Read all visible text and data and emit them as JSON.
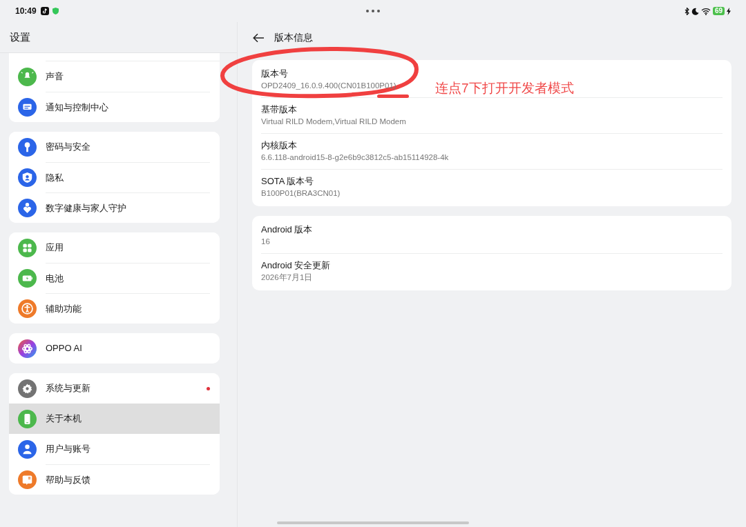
{
  "status_bar": {
    "time": "10:49",
    "battery": "69"
  },
  "sidebar": {
    "title": "设置",
    "groups": [
      {
        "items": [
          {
            "label": "声音",
            "selected": false,
            "dot": false
          },
          {
            "label": "通知与控制中心",
            "selected": false,
            "dot": false
          }
        ]
      },
      {
        "items": [
          {
            "label": "密码与安全",
            "selected": false,
            "dot": false
          },
          {
            "label": "隐私",
            "selected": false,
            "dot": false
          },
          {
            "label": "数字健康与家人守护",
            "selected": false,
            "dot": false
          }
        ]
      },
      {
        "items": [
          {
            "label": "应用",
            "selected": false,
            "dot": false
          },
          {
            "label": "电池",
            "selected": false,
            "dot": false
          },
          {
            "label": "辅助功能",
            "selected": false,
            "dot": false
          }
        ]
      },
      {
        "items": [
          {
            "label": "OPPO AI",
            "selected": false,
            "dot": false
          }
        ]
      },
      {
        "items": [
          {
            "label": "系统与更新",
            "selected": false,
            "dot": true
          },
          {
            "label": "关于本机",
            "selected": true,
            "dot": false
          },
          {
            "label": "用户与账号",
            "selected": false,
            "dot": false
          },
          {
            "label": "帮助与反馈",
            "selected": false,
            "dot": false
          }
        ]
      }
    ]
  },
  "detail": {
    "title": "版本信息",
    "groups": [
      {
        "rows": [
          {
            "label": "版本号",
            "value": "OPD2409_16.0.9.400(CN01B100P01)"
          },
          {
            "label": "基带版本",
            "value": "Virtual RILD Modem,Virtual RILD Modem"
          },
          {
            "label": "内核版本",
            "value": "6.6.118-android15-8-g2e6b9c3812c5-ab15114928-4k"
          },
          {
            "label": "SOTA 版本号",
            "value": "B100P01(BRA3CN01)"
          }
        ]
      },
      {
        "rows": [
          {
            "label": "Android 版本",
            "value": "16"
          },
          {
            "label": "Android 安全更新",
            "value": "2026年7月1日"
          }
        ]
      }
    ]
  },
  "annotation": {
    "text": "连点7下打开开发者模式"
  }
}
